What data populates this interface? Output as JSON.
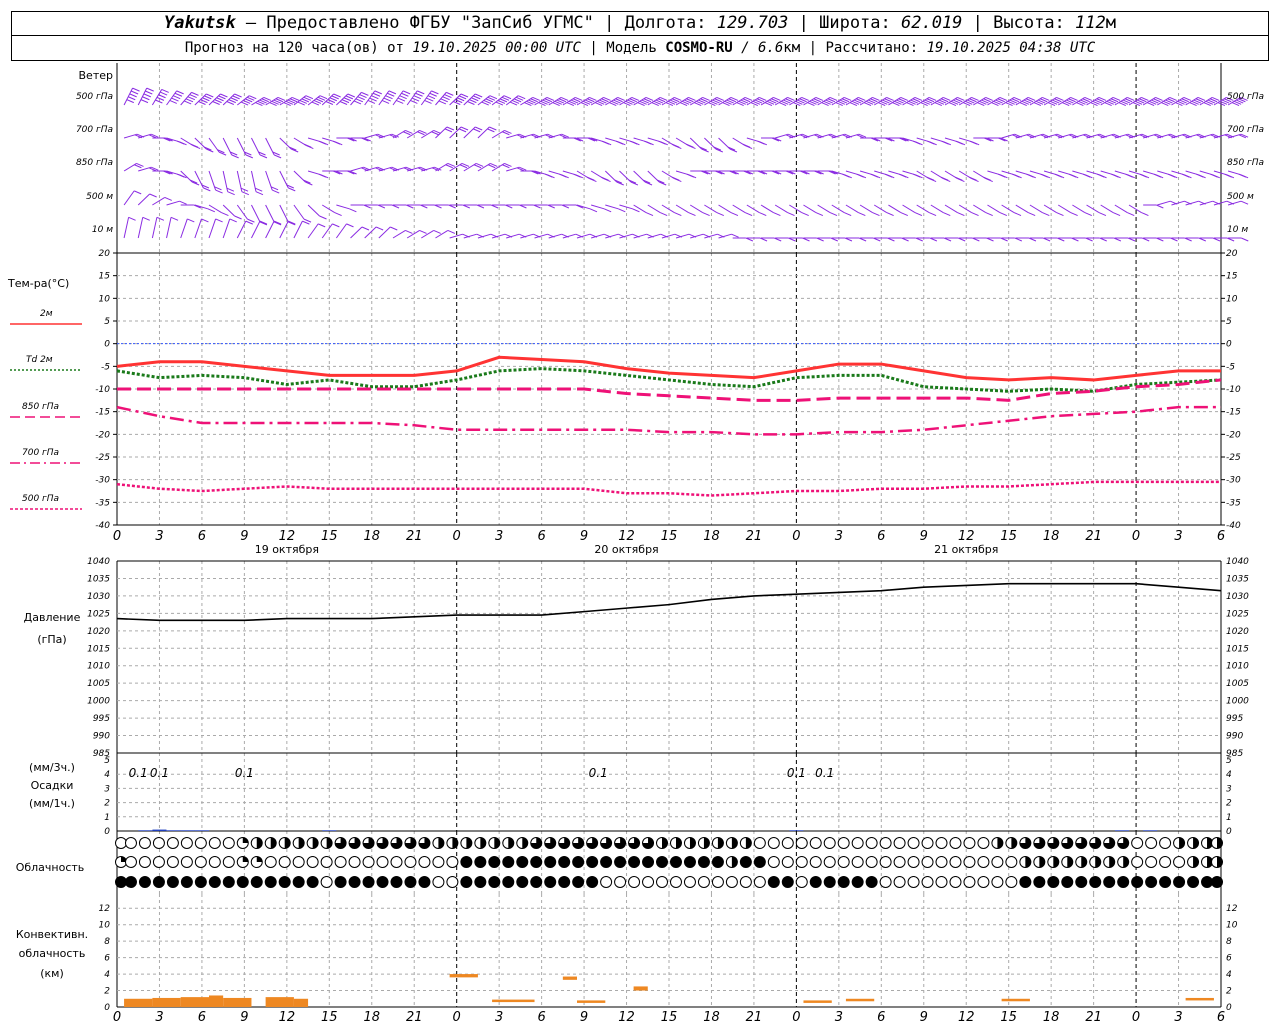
{
  "header": {
    "station": "Yakutsk",
    "dash": " — ",
    "provider": "Предоставлено ФГБУ \"ЗапСиб УГМС\"",
    "sep": " | ",
    "lon_label": "Долгота: ",
    "lon_value": "129.703",
    "lat_label": "Широта: ",
    "lat_value": "62.019",
    "alt_label": "Высота: ",
    "alt_value": "112",
    "alt_unit": "м",
    "forecast_prefix": "Прогноз на 120 часа(ов) от ",
    "forecast_start": "19.10.2025 00:00 UTC",
    "model_label": "| Модель ",
    "model_name": "COSMO-RU",
    "model_res_sep": " / ",
    "model_res": "6.6",
    "model_res_unit": "км",
    "calc_label": " | Рассчитано: ",
    "calc_time": "19.10.2025 04:38 UTC"
  },
  "wind_panel": {
    "title": "Ветер",
    "levels": [
      "500 гПа",
      "700 гПа",
      "850 гПа",
      "500 м",
      "10  м"
    ]
  },
  "temp_panel": {
    "title": "Тем-ра(°C)",
    "legend": [
      {
        "label": "2м",
        "color": "#ff3333",
        "style": "solid"
      },
      {
        "label": "Td  2м",
        "color": "#1a7a1a",
        "style": "dotted"
      },
      {
        "label": "850 гПа",
        "color": "#ee1177",
        "style": "dash"
      },
      {
        "label": "700 гПа",
        "color": "#ee1177",
        "style": "dashdot"
      },
      {
        "label": "500 гПа",
        "color": "#ee1177",
        "style": "dot"
      }
    ],
    "yticks": [
      "20",
      "15",
      "10",
      "5",
      "0",
      "-5",
      "-10",
      "-15",
      "-20",
      "-25",
      "-30",
      "-35",
      "-40"
    ],
    "xticks": [
      "0",
      "3",
      "6",
      "9",
      "12",
      "15",
      "18",
      "21",
      "0",
      "3",
      "6",
      "9",
      "12",
      "15",
      "18",
      "21",
      "0",
      "3",
      "6",
      "9",
      "12",
      "15",
      "18",
      "21",
      "0",
      "3",
      "6"
    ],
    "dates": [
      "19 октября",
      "20 октября",
      "21 октября"
    ]
  },
  "pressure_panel": {
    "title": "Давление",
    "unit": "(гПа)",
    "yticks": [
      "1040",
      "1035",
      "1030",
      "1025",
      "1020",
      "1015",
      "1010",
      "1005",
      "1000",
      "995",
      "990",
      "985"
    ]
  },
  "precip_panel": {
    "unit3": "(мм/3ч.)",
    "title": "Осадки",
    "unit1": "(мм/1ч.)",
    "yticks": [
      "5",
      "4",
      "3",
      "2",
      "1",
      "0"
    ],
    "labels": [
      {
        "hour": 3,
        "text": "0.1"
      },
      {
        "hour": 6,
        "text": "0.1"
      },
      {
        "hour": 18,
        "text": "0.1"
      },
      {
        "hour": 51,
        "text": "0.1"
      },
      {
        "hour": 72,
        "text": "0.1"
      },
      {
        "hour": 75,
        "text": "0.1"
      }
    ]
  },
  "cloud_panel": {
    "title": "Облачность"
  },
  "conv_panel": {
    "title1": "Конвективн.",
    "title2": "облачность",
    "unit": "(км)",
    "yticks": [
      "12",
      "10",
      "8",
      "6",
      "4",
      "2",
      "0"
    ]
  },
  "colors": {
    "wind": "#8a2be2",
    "t2m": "#ff3333",
    "td2m": "#1a7a1a",
    "upper": "#ee1177",
    "zero": "#3355ff",
    "pressure": "#000000",
    "precip": "#1f3fbf",
    "conv": "#ee8822",
    "grid": "#aaaaaa"
  },
  "chart_data": [
    {
      "type": "line",
      "title": "Тем-ра(°C)",
      "xlabel": "",
      "ylabel": "Тем-ра(°C)",
      "ylim": [
        -40,
        20
      ],
      "x": [
        0,
        3,
        6,
        9,
        12,
        15,
        18,
        21,
        24,
        27,
        30,
        33,
        36,
        39,
        42,
        45,
        48,
        51,
        54,
        57,
        60,
        63,
        66,
        69,
        72,
        75,
        78
      ],
      "series": [
        {
          "name": "2м",
          "values": [
            -5,
            -4,
            -4,
            -5,
            -6,
            -7,
            -7,
            -7,
            -6,
            -3,
            -3.5,
            -4,
            -5.5,
            -6.5,
            -7,
            -7.5,
            -6,
            -4.5,
            -4.5,
            -6,
            -7.5,
            -8,
            -7.5,
            -8,
            -7,
            -6,
            -6
          ]
        },
        {
          "name": "Td  2м",
          "values": [
            -6,
            -7.5,
            -7,
            -7.5,
            -9,
            -8,
            -9.5,
            -9.5,
            -8,
            -6,
            -5.5,
            -6,
            -7,
            -8,
            -9,
            -9.5,
            -7.5,
            -7,
            -7,
            -9.5,
            -10,
            -10.5,
            -10,
            -10.5,
            -9,
            -8.5,
            -8
          ]
        },
        {
          "name": "850 гПа",
          "values": [
            -10,
            -10,
            -10,
            -10,
            -10,
            -10,
            -10,
            -10,
            -10,
            -10,
            -10,
            -10,
            -11,
            -11.5,
            -12,
            -12.5,
            -12.5,
            -12,
            -12,
            -12,
            -12,
            -12.5,
            -11,
            -10.5,
            -9.5,
            -9,
            -8
          ]
        },
        {
          "name": "700 гПа",
          "values": [
            -14,
            -16,
            -17.5,
            -17.5,
            -17.5,
            -17.5,
            -17.5,
            -18,
            -19,
            -19,
            -19,
            -19,
            -19,
            -19.5,
            -19.5,
            -20,
            -20,
            -19.5,
            -19.5,
            -19,
            -18,
            -17,
            -16,
            -15.5,
            -15,
            -14,
            -14
          ]
        },
        {
          "name": "500 гПа",
          "values": [
            -31,
            -32,
            -32.5,
            -32,
            -31.5,
            -32,
            -32,
            -32,
            -32,
            -32,
            -32,
            -32,
            -33,
            -33,
            -33.5,
            -33,
            -32.5,
            -32.5,
            -32,
            -32,
            -31.5,
            -31.5,
            -31,
            -30.5,
            -30.5,
            -30.5,
            -30.5
          ]
        }
      ]
    },
    {
      "type": "line",
      "title": "Давление",
      "ylabel": "(гПа)",
      "ylim": [
        985,
        1040
      ],
      "x": [
        0,
        3,
        6,
        9,
        12,
        15,
        18,
        21,
        24,
        27,
        30,
        33,
        36,
        39,
        42,
        45,
        48,
        51,
        54,
        57,
        60,
        63,
        66,
        69,
        72,
        75,
        78
      ],
      "series": [
        {
          "name": "Давление",
          "values": [
            1023.5,
            1023,
            1023,
            1023,
            1023.5,
            1023.5,
            1023.5,
            1024,
            1024.5,
            1024.5,
            1024.5,
            1025.5,
            1026.5,
            1027.5,
            1029,
            1030,
            1030.5,
            1031,
            1031.5,
            1032.5,
            1033,
            1033.5,
            1033.5,
            1033.5,
            1033.5,
            1032.5,
            1031.5
          ]
        }
      ]
    },
    {
      "type": "bar",
      "title": "Осадки",
      "ylabel": "(мм/1ч.)",
      "ylim": [
        0,
        5
      ],
      "x": [
        2,
        3,
        4,
        5,
        6,
        15,
        48,
        71,
        73
      ],
      "values": [
        0.05,
        0.1,
        0.05,
        0.05,
        0.05,
        0.05,
        0.05,
        0.05,
        0.05
      ]
    },
    {
      "type": "bar",
      "title": "Конвективн. облачность",
      "ylabel": "(км)",
      "ylim": [
        0,
        12
      ],
      "segments": [
        {
          "x0": 0.5,
          "x1": 2.5,
          "base": 0,
          "top": 1
        },
        {
          "x0": 2.5,
          "x1": 4.5,
          "base": 0,
          "top": 1.1
        },
        {
          "x0": 4.5,
          "x1": 6.5,
          "base": 0,
          "top": 1.2
        },
        {
          "x0": 6.5,
          "x1": 7.5,
          "base": 0,
          "top": 1.4
        },
        {
          "x0": 7.5,
          "x1": 9.5,
          "base": 0,
          "top": 1.1
        },
        {
          "x0": 10.5,
          "x1": 12.5,
          "base": 0,
          "top": 1.2
        },
        {
          "x0": 12.5,
          "x1": 13.5,
          "base": 0,
          "top": 1
        },
        {
          "x0": 23.5,
          "x1": 25.5,
          "base": 3.6,
          "top": 4
        },
        {
          "x0": 26.5,
          "x1": 29.5,
          "base": 0.7,
          "top": 0.9
        },
        {
          "x0": 31.5,
          "x1": 32.5,
          "base": 3.3,
          "top": 3.7
        },
        {
          "x0": 32.5,
          "x1": 34.5,
          "base": 0.7,
          "top": 0.8
        },
        {
          "x0": 36.5,
          "x1": 37.5,
          "base": 2,
          "top": 2.5
        },
        {
          "x0": 48.5,
          "x1": 50.5,
          "base": 0.7,
          "top": 0.8
        },
        {
          "x0": 51.5,
          "x1": 53.5,
          "base": 0.8,
          "top": 1
        },
        {
          "x0": 62.5,
          "x1": 64.5,
          "base": 0.8,
          "top": 1
        },
        {
          "x0": 75.5,
          "x1": 77.5,
          "base": 1,
          "top": 1.1
        }
      ]
    }
  ],
  "wind_rows": [
    {
      "level": "500 гПа",
      "dir": [
        220,
        220,
        225,
        230,
        235,
        240,
        240,
        240,
        245,
        250,
        250,
        250,
        245,
        245,
        240,
        240,
        235,
        230,
        230,
        230,
        230,
        230,
        235,
        240,
        240,
        245,
        245,
        245,
        250,
        250,
        250,
        250,
        250,
        250,
        250,
        250,
        250,
        250,
        250,
        250,
        250,
        250,
        250,
        250,
        250,
        250,
        250,
        250,
        250,
        250,
        250,
        250,
        250,
        250,
        250,
        250,
        250,
        250,
        250,
        250,
        250,
        250,
        250,
        250,
        250,
        250,
        250,
        250,
        250,
        250,
        250,
        250,
        250,
        250,
        250,
        250,
        250,
        250,
        250
      ],
      "spd": [
        50
      ]
    },
    {
      "level": "700 гПа",
      "dir": [
        260,
        260,
        270,
        280,
        290,
        300,
        310,
        320,
        320,
        320,
        320,
        300,
        290,
        280,
        280,
        270,
        270,
        260,
        260,
        250,
        250,
        250,
        240,
        240,
        240,
        240,
        250,
        260,
        260,
        260,
        260,
        270,
        270,
        280,
        280,
        280,
        280,
        280,
        290,
        290,
        300,
        300,
        300,
        290,
        280,
        270,
        260,
        260,
        260,
        260,
        260,
        260,
        270,
        270,
        270,
        280,
        280,
        280,
        280,
        280,
        270,
        270,
        260,
        260,
        260,
        260,
        260,
        260,
        260,
        260,
        260,
        260,
        260,
        260,
        260,
        260,
        260,
        260,
        260
      ],
      "spd": [
        25
      ]
    },
    {
      "level": "850 гПа",
      "dir": [
        250,
        260,
        270,
        280,
        300,
        320,
        330,
        340,
        340,
        340,
        330,
        320,
        300,
        280,
        270,
        270,
        260,
        260,
        260,
        260,
        260,
        260,
        250,
        250,
        250,
        250,
        250,
        260,
        270,
        280,
        280,
        280,
        290,
        290,
        300,
        300,
        300,
        300,
        290,
        280,
        270,
        270,
        270,
        270,
        270,
        270,
        270,
        270,
        270,
        270,
        280,
        280,
        280,
        280,
        280,
        280,
        290,
        290,
        290,
        290,
        290,
        280,
        280,
        280,
        280,
        280,
        280,
        280,
        280,
        280,
        280,
        280,
        280,
        280,
        280,
        280,
        280,
        280,
        280
      ],
      "spd": [
        20
      ]
    },
    {
      "level": "500 м",
      "dir": [
        230,
        240,
        250,
        260,
        270,
        280,
        290,
        300,
        310,
        320,
        320,
        320,
        310,
        300,
        290,
        280,
        270,
        270,
        270,
        270,
        270,
        270,
        270,
        270,
        270,
        270,
        270,
        270,
        270,
        270,
        270,
        270,
        280,
        280,
        280,
        280,
        290,
        290,
        290,
        290,
        290,
        290,
        290,
        290,
        290,
        290,
        290,
        290,
        290,
        290,
        290,
        290,
        290,
        290,
        290,
        290,
        290,
        290,
        290,
        290,
        290,
        290,
        290,
        290,
        290,
        290,
        290,
        290,
        290,
        290,
        290,
        290,
        270,
        260,
        260,
        260,
        260,
        260,
        260
      ],
      "spd": [
        15
      ]
    },
    {
      "level": "10  м",
      "dir": [
        200,
        200,
        200,
        200,
        210,
        210,
        210,
        210,
        220,
        220,
        220,
        220,
        220,
        230,
        230,
        230,
        240,
        240,
        240,
        250,
        250,
        250,
        250,
        260,
        260,
        260,
        260,
        260,
        260,
        260,
        260,
        260,
        260,
        260,
        260,
        260,
        260,
        260,
        260,
        260,
        260,
        260,
        260,
        270,
        270,
        270,
        270,
        270,
        270,
        270,
        270,
        270,
        270,
        270,
        270,
        270,
        270,
        270,
        270,
        270,
        270,
        270,
        270,
        270,
        270,
        270,
        270,
        270,
        270,
        270,
        270,
        270,
        270,
        270,
        270,
        270,
        270,
        270,
        270
      ],
      "spd": [
        8
      ]
    }
  ],
  "clouds": {
    "rows": [
      [
        0,
        0,
        0,
        0,
        0,
        0,
        0,
        0,
        0,
        1,
        2,
        2,
        2,
        2,
        2,
        2,
        3,
        3,
        3,
        3,
        3,
        3,
        3,
        2,
        2,
        2,
        2,
        2,
        2,
        2,
        3,
        3,
        3,
        3,
        3,
        3,
        3,
        3,
        3,
        2,
        2,
        2,
        2,
        2,
        2,
        2,
        0,
        0,
        0,
        0,
        0,
        0,
        0,
        0,
        0,
        0,
        0,
        0,
        0,
        0,
        0,
        0,
        0,
        2,
        2,
        3,
        3,
        3,
        3,
        3,
        3,
        3,
        3,
        0,
        0,
        0,
        2,
        2,
        2,
        2
      ],
      [
        1,
        0,
        0,
        0,
        0,
        0,
        0,
        0,
        0,
        1,
        1,
        0,
        0,
        0,
        0,
        0,
        0,
        0,
        0,
        0,
        0,
        0,
        0,
        0,
        0,
        4,
        4,
        4,
        4,
        4,
        4,
        4,
        4,
        4,
        4,
        4,
        4,
        4,
        4,
        4,
        4,
        4,
        4,
        4,
        2,
        4,
        4,
        0,
        0,
        0,
        0,
        0,
        0,
        0,
        0,
        0,
        0,
        0,
        0,
        0,
        0,
        0,
        0,
        0,
        0,
        2,
        2,
        2,
        2,
        2,
        2,
        2,
        2,
        0,
        0,
        0,
        0,
        2,
        2,
        2
      ],
      [
        4,
        4,
        4,
        4,
        4,
        4,
        4,
        4,
        4,
        4,
        4,
        4,
        4,
        4,
        4,
        0,
        4,
        4,
        4,
        4,
        4,
        4,
        4,
        0,
        0,
        4,
        4,
        4,
        4,
        4,
        4,
        4,
        4,
        4,
        4,
        0,
        0,
        0,
        0,
        0,
        0,
        0,
        0,
        0,
        0,
        0,
        0,
        4,
        4,
        0,
        4,
        4,
        4,
        4,
        4,
        0,
        0,
        0,
        0,
        0,
        0,
        0,
        0,
        0,
        0,
        4,
        4,
        4,
        4,
        4,
        4,
        4,
        4,
        4,
        4,
        4,
        4,
        4,
        4,
        4
      ]
    ]
  }
}
